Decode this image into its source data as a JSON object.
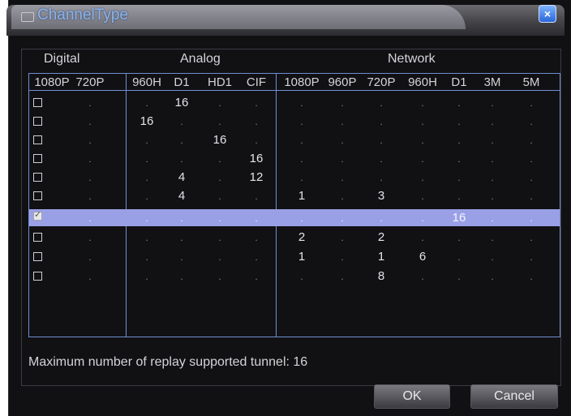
{
  "dialog": {
    "title": "ChannelType",
    "close_label": "×"
  },
  "groups": {
    "digital": "Digital",
    "analog": "Analog",
    "network": "Network"
  },
  "columns": [
    "1080P",
    "720P",
    "960H",
    "D1",
    "HD1",
    "CIF",
    "1080P",
    "960P",
    "720P",
    "960H",
    "D1",
    "3M",
    "5M"
  ],
  "rows": [
    {
      "checked": false,
      "cells": [
        ".",
        ".",
        ".",
        "16",
        ".",
        ".",
        ".",
        ".",
        ".",
        ".",
        ".",
        ".",
        "."
      ]
    },
    {
      "checked": false,
      "cells": [
        ".",
        ".",
        "16",
        ".",
        ".",
        ".",
        ".",
        ".",
        ".",
        ".",
        ".",
        ".",
        "."
      ]
    },
    {
      "checked": false,
      "cells": [
        ".",
        ".",
        ".",
        ".",
        "16",
        ".",
        ".",
        ".",
        ".",
        ".",
        ".",
        ".",
        "."
      ]
    },
    {
      "checked": false,
      "cells": [
        ".",
        ".",
        ".",
        ".",
        ".",
        "16",
        ".",
        ".",
        ".",
        ".",
        ".",
        ".",
        "."
      ]
    },
    {
      "checked": false,
      "cells": [
        ".",
        ".",
        ".",
        "4",
        ".",
        "12",
        ".",
        ".",
        ".",
        ".",
        ".",
        ".",
        "."
      ]
    },
    {
      "checked": false,
      "cells": [
        ".",
        ".",
        ".",
        "4",
        ".",
        ".",
        "1",
        ".",
        "3",
        ".",
        ".",
        ".",
        "."
      ]
    },
    {
      "checked": true,
      "cells": [
        ".",
        ".",
        ".",
        ".",
        ".",
        ".",
        ".",
        ".",
        ".",
        ".",
        "16",
        ".",
        "."
      ]
    },
    {
      "checked": false,
      "cells": [
        ".",
        ".",
        ".",
        ".",
        ".",
        ".",
        "2",
        ".",
        "2",
        ".",
        ".",
        ".",
        "."
      ]
    },
    {
      "checked": false,
      "cells": [
        ".",
        ".",
        ".",
        ".",
        ".",
        ".",
        "1",
        ".",
        "1",
        "6",
        ".",
        ".",
        "."
      ]
    },
    {
      "checked": false,
      "cells": [
        ".",
        ".",
        ".",
        ".",
        ".",
        ".",
        ".",
        ".",
        "8",
        ".",
        ".",
        ".",
        "."
      ]
    }
  ],
  "footnote": "Maximum number of replay supported tunnel: 16",
  "buttons": {
    "ok": "OK",
    "cancel": "Cancel"
  },
  "colors": {
    "selected_row": "#9aa0e6",
    "grid_border": "#6f8fd0",
    "title_text": "#8cb4ea"
  }
}
